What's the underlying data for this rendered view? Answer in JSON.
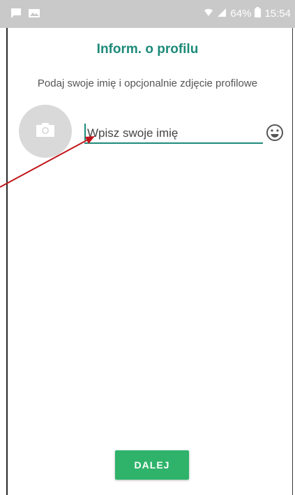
{
  "status_bar": {
    "battery": "64%",
    "time": "15:54",
    "icons": [
      "chat-notification-icon",
      "image-notification-icon",
      "wifi-icon",
      "signal-icon",
      "battery-icon"
    ]
  },
  "header": {
    "title": "Inform. o profilu"
  },
  "profile": {
    "subtitle": "Podaj swoje imię i opcjonalnie zdjęcie profilowe",
    "name_placeholder": "Wpisz swoje imię",
    "name_value": "",
    "avatar_icon": "camera-icon",
    "emoji_icon": "smiley-icon"
  },
  "footer": {
    "next_label": "DALEJ"
  },
  "colors": {
    "accent": "#1d8a79",
    "button": "#2fb36b",
    "status_bar": "#c9c9c9",
    "avatar_bg": "#d9d9d9",
    "annotation_arrow": "#c0161b"
  }
}
